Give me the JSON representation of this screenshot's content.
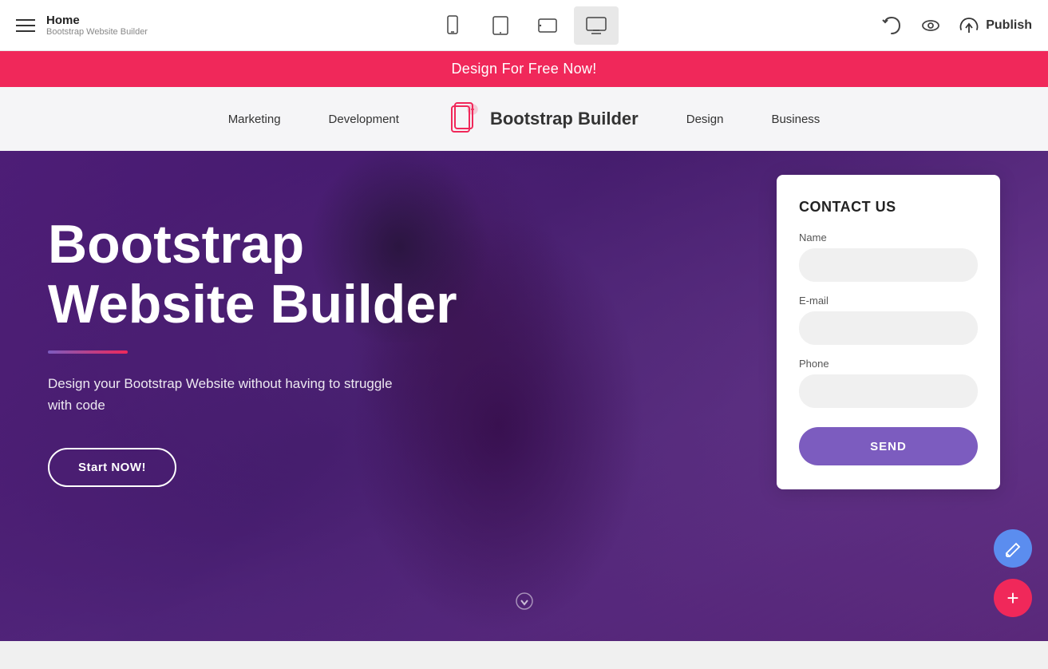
{
  "topbar": {
    "home_title": "Home",
    "home_subtitle": "Bootstrap Website Builder",
    "publish_label": "Publish",
    "devices": [
      {
        "name": "mobile",
        "label": "Mobile",
        "active": false
      },
      {
        "name": "tablet",
        "label": "Tablet",
        "active": false
      },
      {
        "name": "tablet-landscape",
        "label": "Tablet Landscape",
        "active": false
      },
      {
        "name": "desktop",
        "label": "Desktop",
        "active": true
      }
    ]
  },
  "promo": {
    "text": "Design For Free Now!"
  },
  "sitenav": {
    "brand_name": "Bootstrap Builder",
    "items": [
      {
        "label": "Marketing"
      },
      {
        "label": "Development"
      },
      {
        "label": "Design"
      },
      {
        "label": "Business"
      }
    ]
  },
  "hero": {
    "title_line1": "Bootstrap",
    "title_line2": "Website Builder",
    "subtitle": "Design your Bootstrap Website without having to struggle with code",
    "cta_label": "Start NOW!"
  },
  "contact": {
    "title": "CONTACT US",
    "name_label": "Name",
    "name_placeholder": "",
    "email_label": "E-mail",
    "email_placeholder": "",
    "phone_label": "Phone",
    "phone_placeholder": "",
    "send_label": "SEND"
  },
  "fab": {
    "pencil_label": "✎",
    "plus_label": "+"
  },
  "colors": {
    "primary_pink": "#f0285a",
    "primary_purple": "#7c5cbf",
    "active_device_bg": "#e8e8e8"
  }
}
